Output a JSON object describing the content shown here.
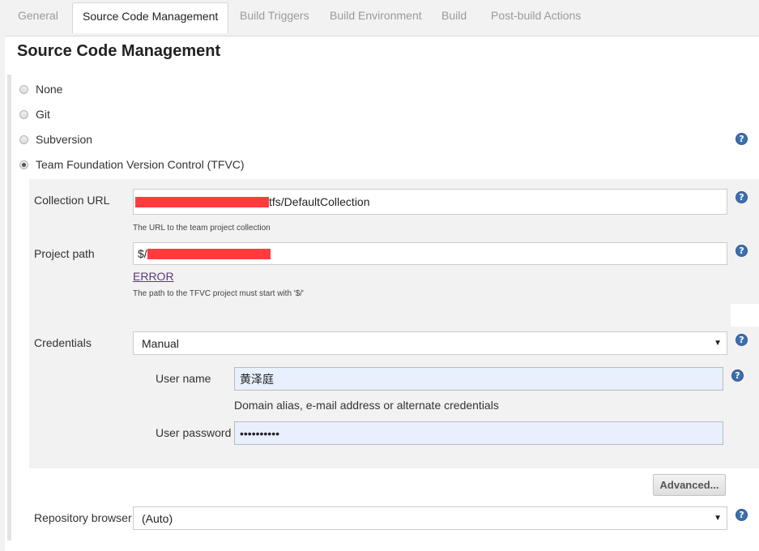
{
  "tabs": [
    {
      "label": "General"
    },
    {
      "label": "Source Code Management"
    },
    {
      "label": "Build Triggers"
    },
    {
      "label": "Build Environment"
    },
    {
      "label": "Build"
    },
    {
      "label": "Post-build Actions"
    }
  ],
  "active_tab": "Source Code Management",
  "section_title": "Source Code Management",
  "scm_options": [
    {
      "label": "None",
      "checked": false
    },
    {
      "label": "Git",
      "checked": false
    },
    {
      "label": "Subversion",
      "checked": false
    },
    {
      "label": "Team Foundation Version Control (TFVC)",
      "checked": true
    }
  ],
  "help_glyph": "?",
  "tfvc": {
    "collection_url": {
      "label": "Collection URL",
      "value_suffix": "tfs/DefaultCollection",
      "hint": "The URL to the team project collection"
    },
    "project_path": {
      "label": "Project path",
      "value_prefix": "$/",
      "error": "ERROR",
      "hint": "The path to the TFVC project must start with '$/'"
    },
    "credentials": {
      "label": "Credentials",
      "selected": "Manual",
      "user_name_label": "User name",
      "user_name_value": "黄泽庭",
      "user_name_hint": "Domain alias, e-mail address or alternate credentials",
      "password_label": "User password",
      "password_value": "••••••••••"
    },
    "advanced_button": "Advanced...",
    "repository_browser": {
      "label": "Repository browser",
      "selected": "(Auto)"
    }
  },
  "colors": {
    "redaction": "#ff3b3b",
    "help_icon": "#3d6fb0",
    "error_link": "#5b3a7a",
    "autofill_bg": "#e8f0fe"
  }
}
